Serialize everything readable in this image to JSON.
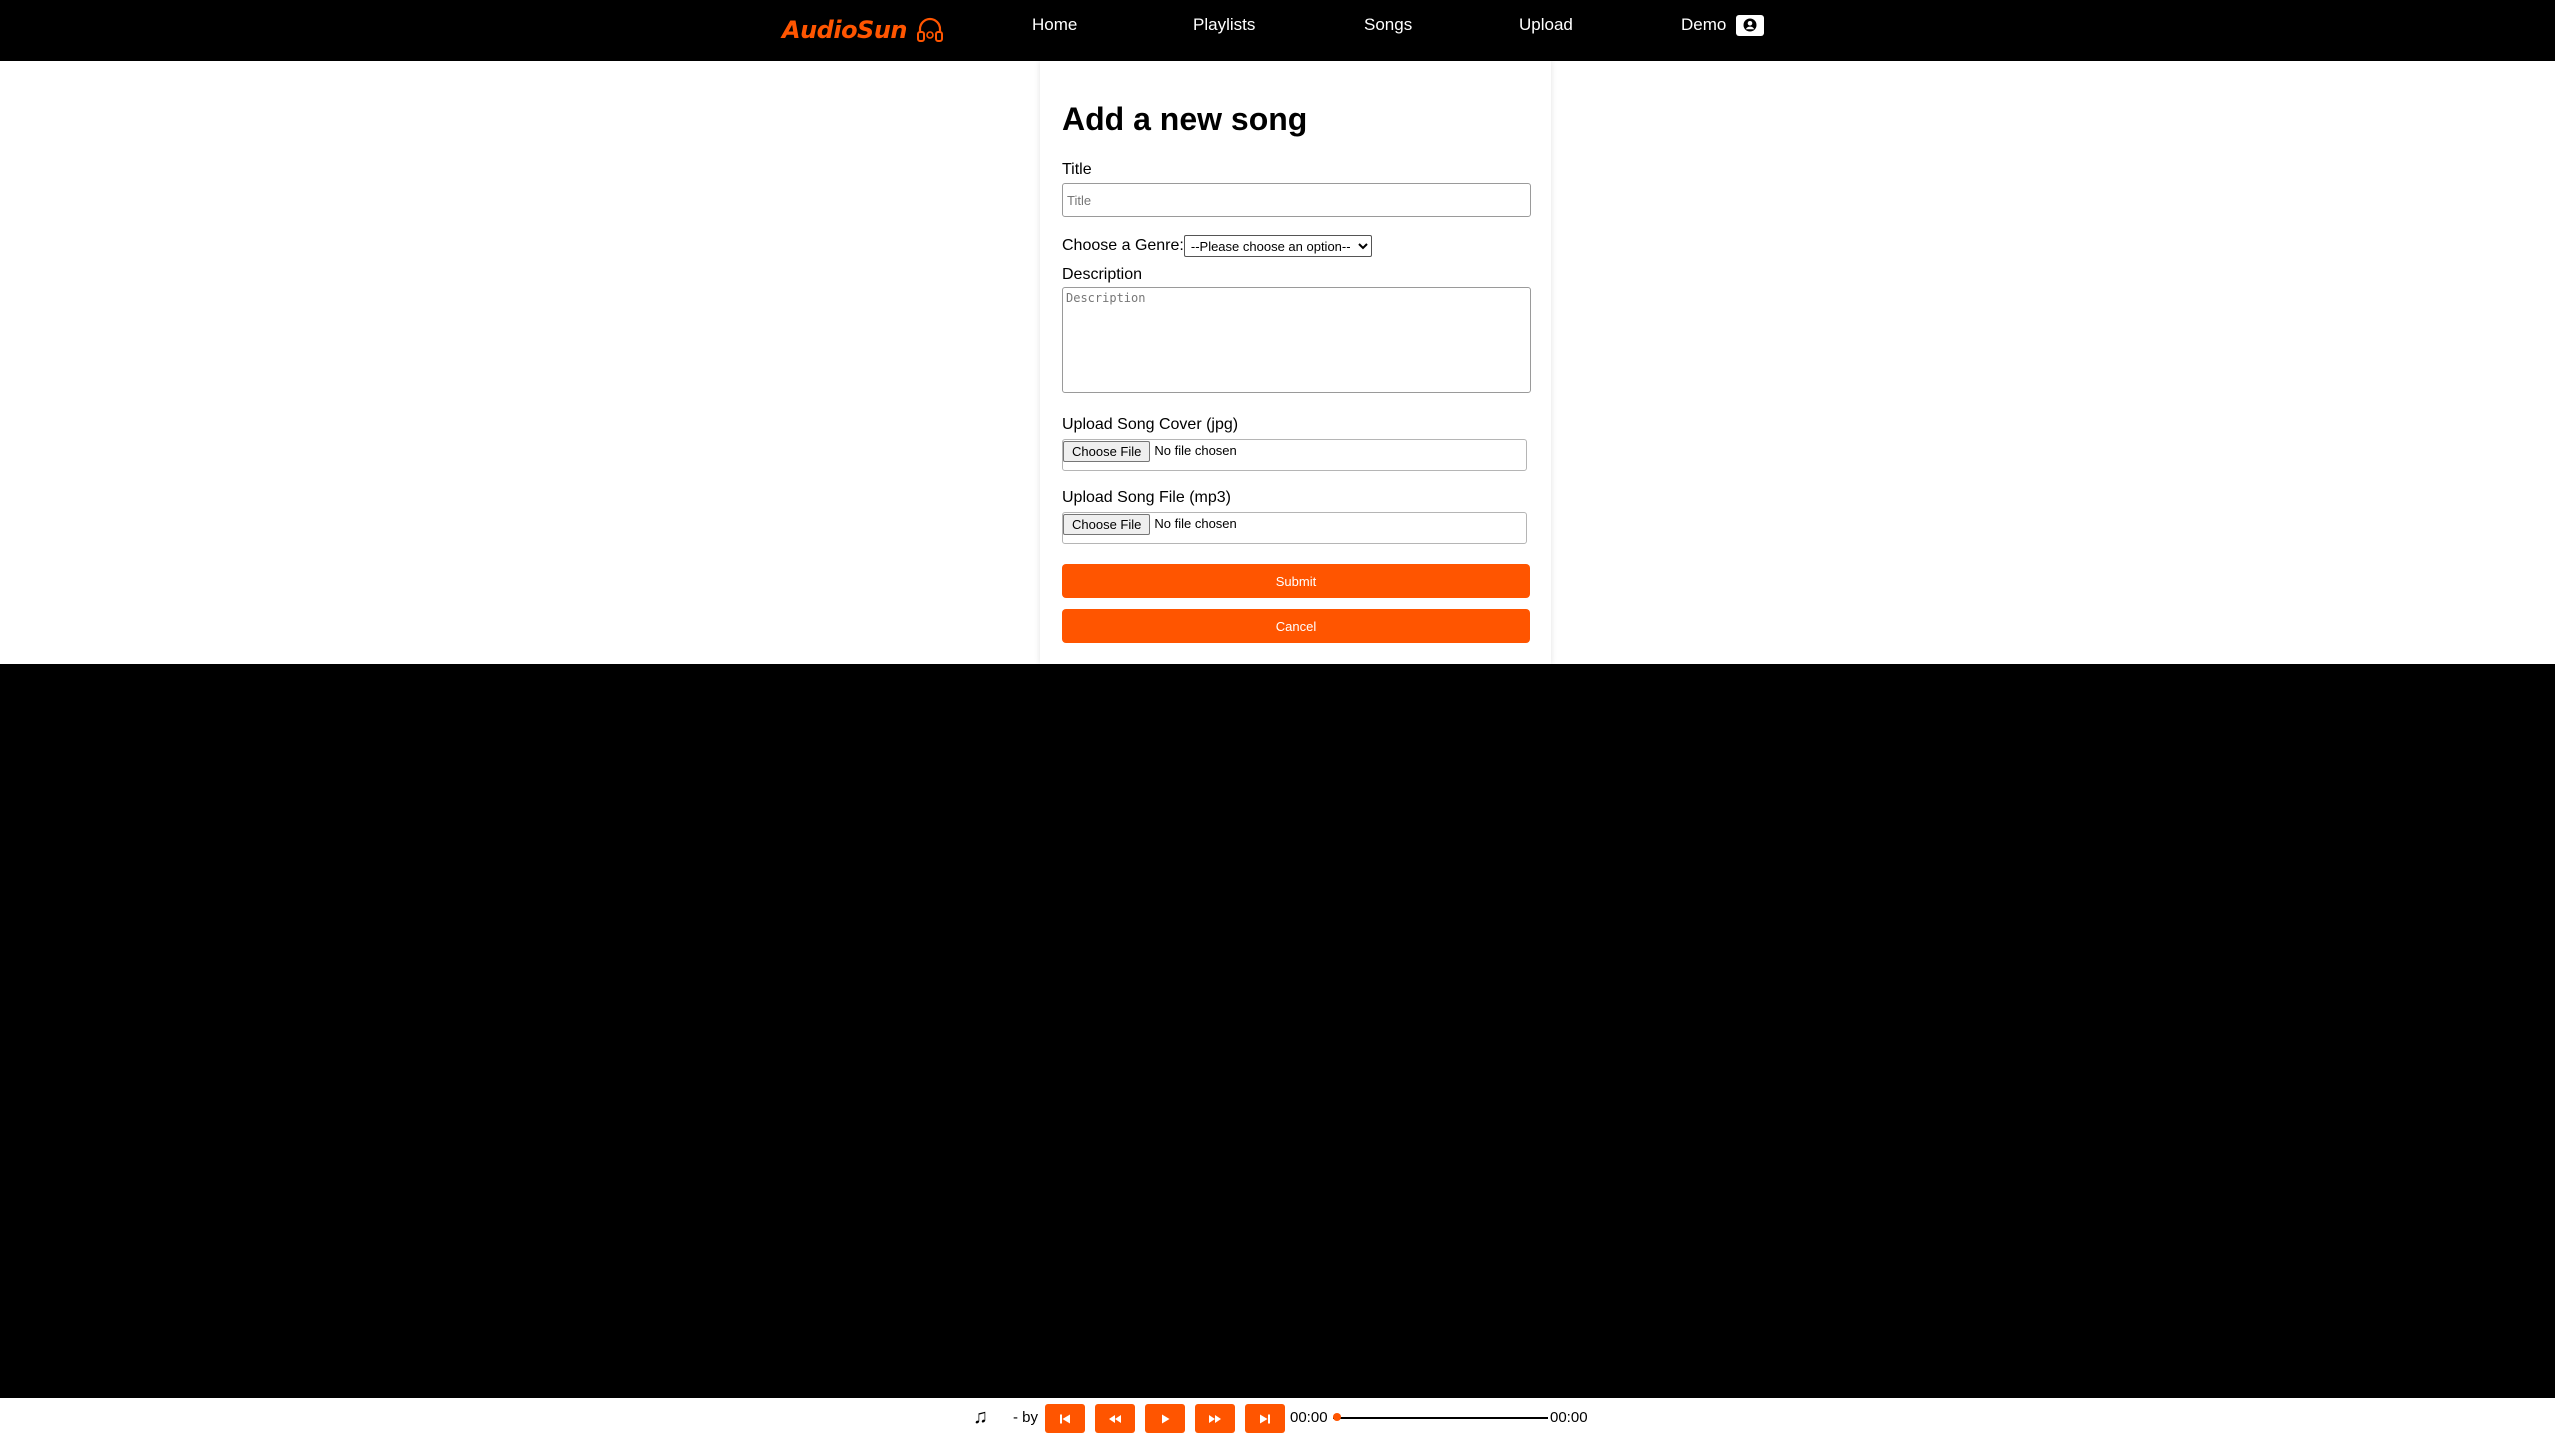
{
  "brand": {
    "name": "AudioSun",
    "accent_color": "#ff5500"
  },
  "nav": {
    "home": "Home",
    "playlists": "Playlists",
    "songs": "Songs",
    "upload": "Upload",
    "user": "Demo",
    "user_icon": "user-circle-icon"
  },
  "form": {
    "title": "Add a new song",
    "title_label": "Title",
    "title_placeholder": "Title",
    "title_value": "",
    "genre_label": "Choose a Genre:",
    "genre_selected": "--Please choose an option--",
    "description_label": "Description",
    "description_placeholder": "Description",
    "description_value": "",
    "cover_label": "Upload Song Cover (jpg)",
    "cover_button": "Choose File",
    "cover_status": "No file chosen",
    "song_label": "Upload Song File (mp3)",
    "song_button": "Choose File",
    "song_status": "No file chosen",
    "submit": "Submit",
    "cancel": "Cancel"
  },
  "player": {
    "note_icon": "music-note-icon",
    "track_title": "",
    "separator": "- by",
    "artist": "",
    "controls": [
      "skip-back-icon",
      "rewind-icon",
      "play-icon",
      "fast-forward-icon",
      "skip-forward-icon"
    ],
    "current_time": "00:00",
    "duration": "00:00",
    "progress": 0
  }
}
